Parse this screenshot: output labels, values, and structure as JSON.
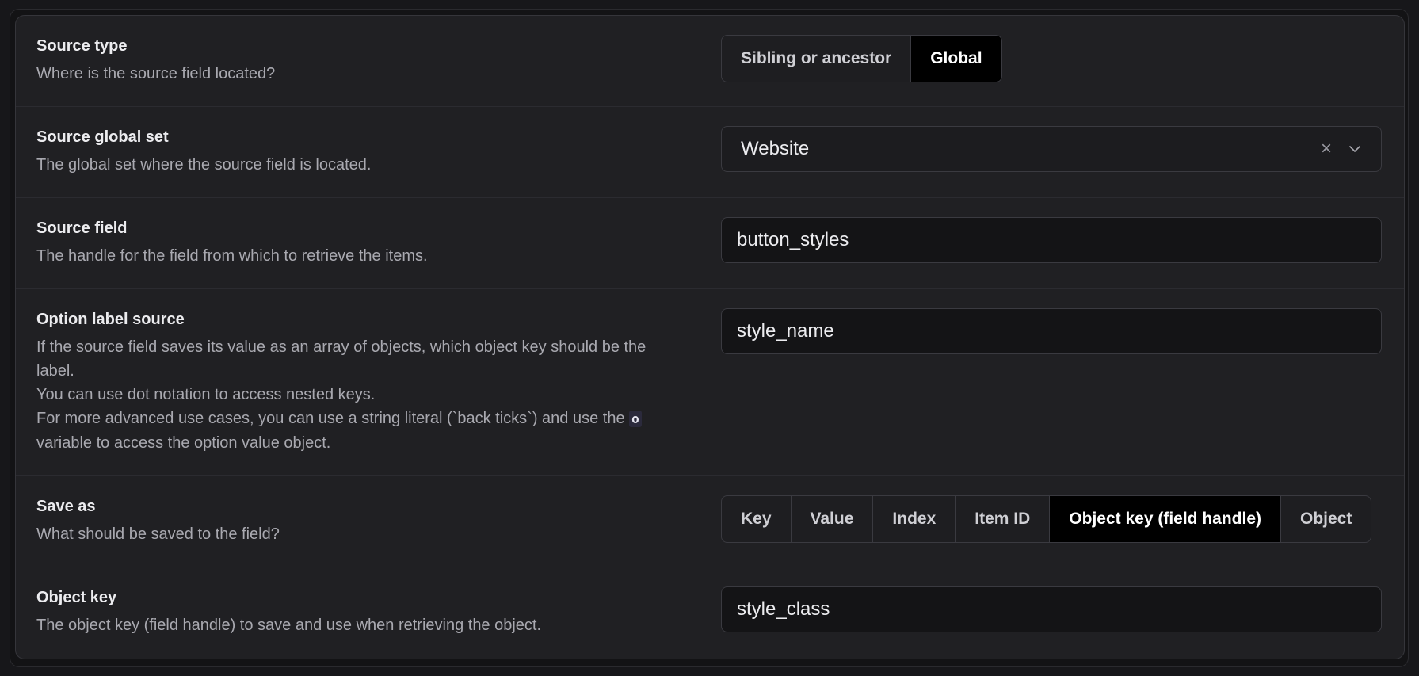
{
  "fields": {
    "source_type": {
      "title": "Source type",
      "desc": "Where is the source field located?",
      "options": [
        "Sibling or ancestor",
        "Global"
      ],
      "selected": "Global"
    },
    "source_global_set": {
      "title": "Source global set",
      "desc": "The global set where the source field is located.",
      "value": "Website",
      "clear_glyph": "×",
      "icon": "chevron-down-icon"
    },
    "source_field": {
      "title": "Source field",
      "desc": "The handle for the field from which to retrieve the items.",
      "value": "button_styles"
    },
    "option_label_source": {
      "title": "Option label source",
      "desc_line1": "If the source field saves its value as an array of objects, which object key should be the",
      "desc_line2": "label.",
      "desc_line3": "You can use dot notation to access nested keys.",
      "desc_line4a": "For more advanced use cases, you can use a string literal (`back ticks`) and use the",
      "desc_code": "o",
      "desc_line5": "variable to access the option value object.",
      "value": "style_name"
    },
    "save_as": {
      "title": "Save as",
      "desc": "What should be saved to the field?",
      "options": [
        "Key",
        "Value",
        "Index",
        "Item ID",
        "Object key (field handle)",
        "Object"
      ],
      "selected": "Object key (field handle)"
    },
    "object_key": {
      "title": "Object key",
      "desc": "The object key (field handle) to save and use when retrieving the object.",
      "value": "style_class"
    }
  },
  "colors": {
    "background": "#17171a",
    "card": "#202023",
    "active_segment": "#000000"
  }
}
